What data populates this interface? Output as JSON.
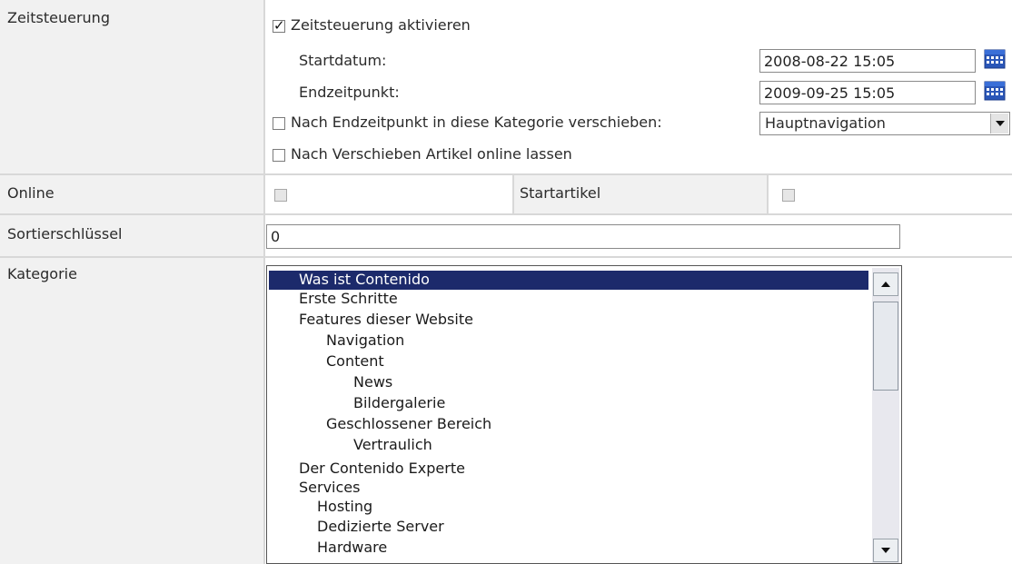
{
  "timing": {
    "section_label": "Zeitsteuerung",
    "enable_label": "Zeitsteuerung aktivieren",
    "enable_checked": true,
    "start_label": "Startdatum:",
    "start_value": "2008-08-22 15:05",
    "end_label": "Endzeitpunkt:",
    "end_value": "2009-09-25 15:05",
    "move_label": "Nach Endzeitpunkt in diese Kategorie verschieben:",
    "move_checked": false,
    "move_category_selected": "Hauptnavigation",
    "keep_online_label": "Nach Verschieben Artikel online lassen",
    "keep_online_checked": false
  },
  "online": {
    "label": "Online",
    "checked": false,
    "start_article_label": "Startartikel",
    "start_article_checked": false
  },
  "sort": {
    "label": "Sortierschlüssel",
    "value": "0"
  },
  "category": {
    "label": "Kategorie",
    "items": [
      {
        "label": "Was ist Contenido",
        "selected": true
      },
      {
        "label": "Erste Schritte",
        "selected": false
      },
      {
        "label": "Features dieser Website",
        "selected": false
      },
      {
        "label": "Navigation",
        "selected": false
      },
      {
        "label": "Content",
        "selected": false
      },
      {
        "label": "News",
        "selected": false
      },
      {
        "label": "Bildergalerie",
        "selected": false
      },
      {
        "label": "Geschlossener Bereich",
        "selected": false
      },
      {
        "label": "Vertraulich",
        "selected": false
      },
      {
        "label": "Der Contenido Experte",
        "selected": false
      },
      {
        "label": "Services",
        "selected": false
      },
      {
        "label": "Hosting",
        "selected": false
      },
      {
        "label": "Dedizierte Server",
        "selected": false
      },
      {
        "label": "Hardware",
        "selected": false
      }
    ]
  },
  "colors": {
    "label_bg": "#f1f1f1",
    "selected_bg": "#1c2a6b",
    "grid_line": "#d8d8d8"
  }
}
